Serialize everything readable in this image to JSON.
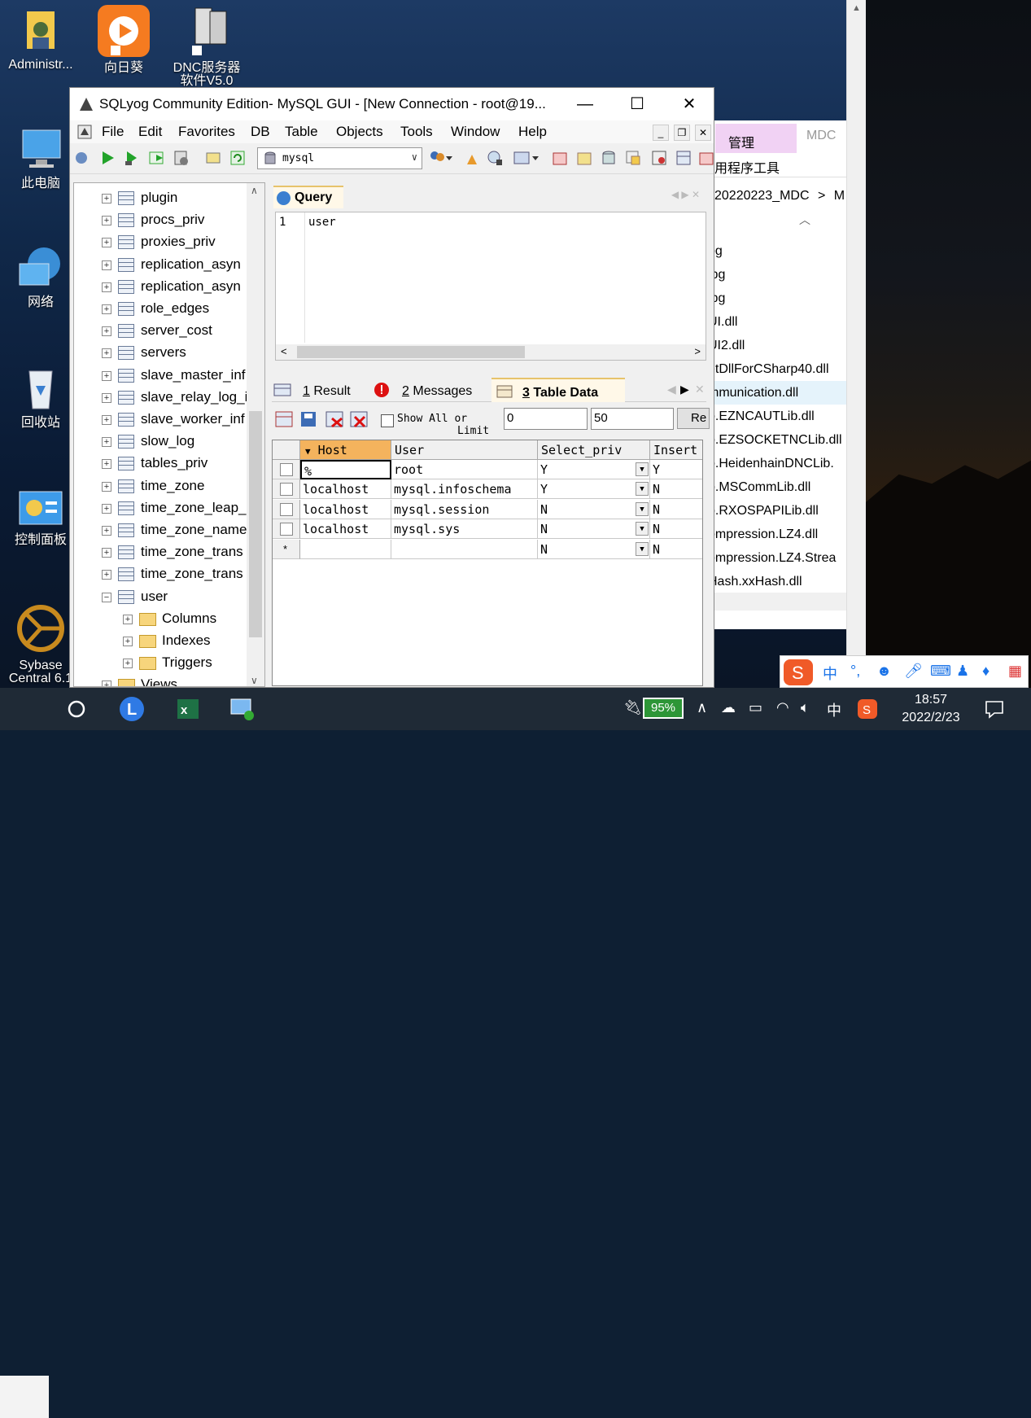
{
  "desktop": {
    "icons": [
      {
        "label": "Administr..."
      },
      {
        "label": "向日葵"
      },
      {
        "label": "DNC服务器"
      },
      {
        "label": "此电脑"
      },
      {
        "label": "网络"
      },
      {
        "label": "回收站"
      },
      {
        "label": "控制面板"
      },
      {
        "label": "Sybase"
      }
    ],
    "dnc_sub": "软件V5.0",
    "sybase_sub": "Central 6.1"
  },
  "explorer": {
    "tab_manage": "管理",
    "tab_mdc": "MDC",
    "ribbon_sub": "用程序工具",
    "path": "20220223_MDC",
    "path_sep": ">",
    "path_more": "M",
    "files": [
      "og",
      "jpg",
      "jpg",
      "UI.dll",
      "UI2.dll",
      "etDllForCSharp40.dll",
      "mmunication.dll",
      "p.EZNCAUTLib.dll",
      "p.EZSOCKETNCLib.dll",
      "p.HeidenhainDNCLib.",
      "p.MSCommLib.dll",
      "p.RXOSPAPILib.dll",
      "ompression.LZ4.dll",
      "ompression.LZ4.Strea",
      "Hash.xxHash.dll"
    ]
  },
  "sqlyog": {
    "title": "SQLyog Community Edition- MySQL GUI - [New Connection - root@19...",
    "menu": [
      "File",
      "Edit",
      "Favorites",
      "DB",
      "Table",
      "Objects",
      "Tools",
      "Window",
      "Help"
    ],
    "database": "mysql",
    "tree": [
      {
        "label": "plugin"
      },
      {
        "label": "procs_priv"
      },
      {
        "label": "proxies_priv"
      },
      {
        "label": "replication_asyn"
      },
      {
        "label": "replication_asyn"
      },
      {
        "label": "role_edges"
      },
      {
        "label": "server_cost"
      },
      {
        "label": "servers"
      },
      {
        "label": "slave_master_inf"
      },
      {
        "label": "slave_relay_log_i"
      },
      {
        "label": "slave_worker_inf"
      },
      {
        "label": "slow_log"
      },
      {
        "label": "tables_priv"
      },
      {
        "label": "time_zone"
      },
      {
        "label": "time_zone_leap_"
      },
      {
        "label": "time_zone_name"
      },
      {
        "label": "time_zone_trans"
      },
      {
        "label": "time_zone_trans"
      },
      {
        "label": "user"
      },
      {
        "label": "Columns"
      },
      {
        "label": "Indexes"
      },
      {
        "label": "Triggers"
      },
      {
        "label": "Views"
      }
    ],
    "query_tab": "Query",
    "editor": {
      "line_no": "1",
      "code": "user"
    },
    "result_tabs": [
      {
        "num": "1",
        "label": "Result"
      },
      {
        "num": "2",
        "label": "Messages"
      },
      {
        "num": "3",
        "label": "Table Data"
      }
    ],
    "show_all": "Show All or",
    "limit": "Limit",
    "limit_from": "0",
    "limit_count": "50",
    "refresh_label": "Re",
    "grid": {
      "columns": [
        "Host",
        "User",
        "Select_priv",
        "Insert"
      ],
      "rows": [
        [
          "%",
          "root",
          "Y",
          "Y"
        ],
        [
          "localhost",
          "mysql.infoschema",
          "Y",
          "N"
        ],
        [
          "localhost",
          "mysql.session",
          "N",
          "N"
        ],
        [
          "localhost",
          "mysql.sys",
          "N",
          "N"
        ],
        [
          "",
          "",
          "N",
          "N"
        ]
      ],
      "new_row_marker": "*"
    }
  },
  "taskbar": {
    "battery": "95%",
    "ime": "中",
    "time": "18:57",
    "date": "2022/2/23"
  },
  "imebar": {
    "label": "中"
  }
}
